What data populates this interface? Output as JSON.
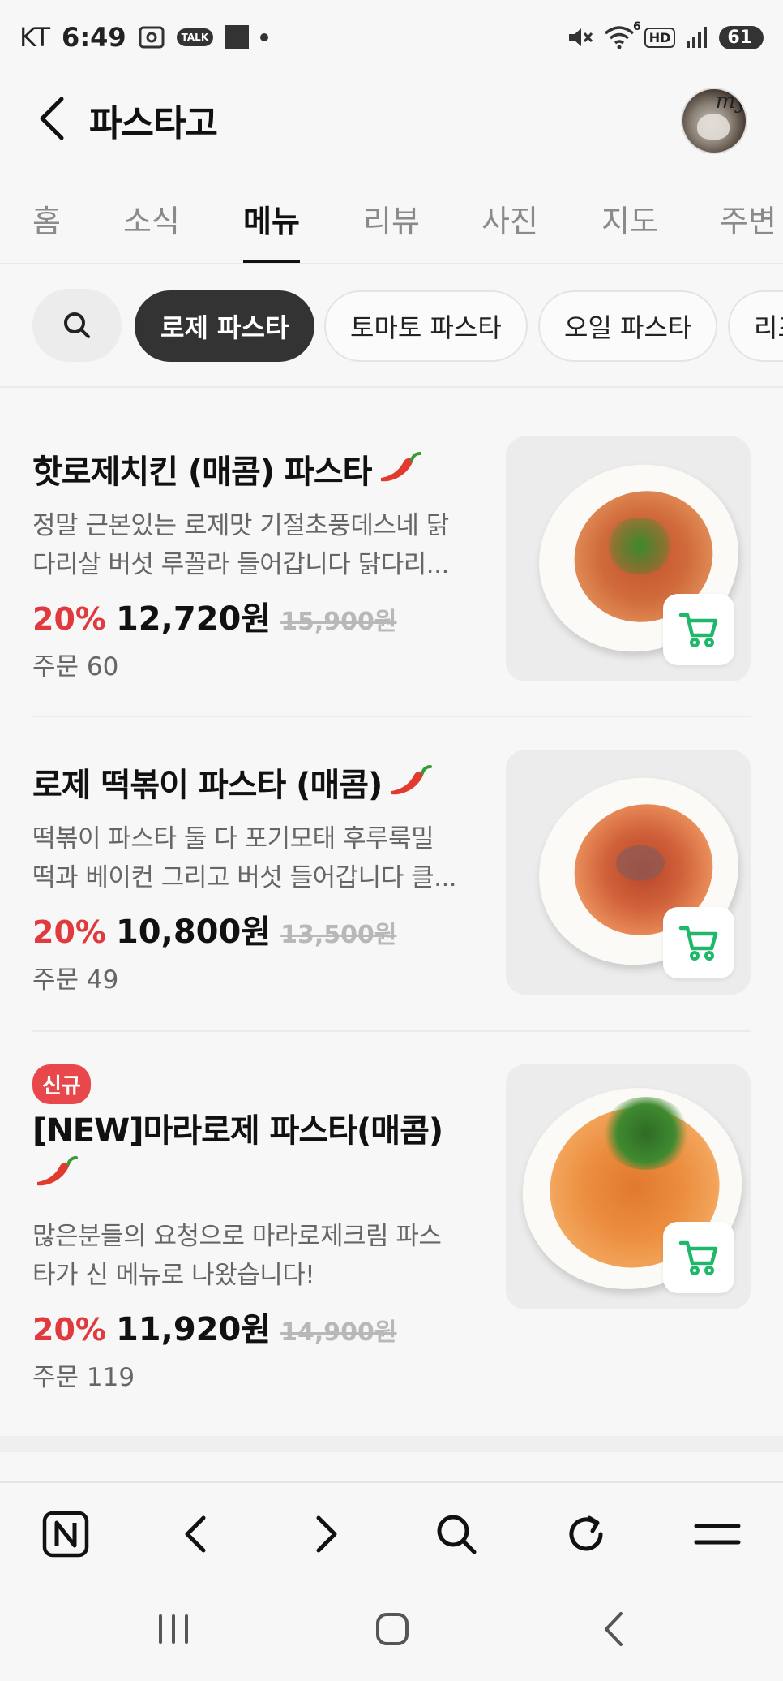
{
  "status_bar": {
    "carrier": "KT",
    "time": "6:49",
    "talk_label": "TALK",
    "hd_label": "HD",
    "network_superscript": "6",
    "battery": "61"
  },
  "header": {
    "title": "파스타고",
    "avatar_text": "my"
  },
  "tabs": [
    {
      "label": "홈",
      "active": false
    },
    {
      "label": "소식",
      "active": false
    },
    {
      "label": "메뉴",
      "active": true
    },
    {
      "label": "리뷰",
      "active": false
    },
    {
      "label": "사진",
      "active": false
    },
    {
      "label": "지도",
      "active": false
    },
    {
      "label": "주변",
      "active": false
    }
  ],
  "filters": {
    "chips": [
      "로제 파스타",
      "토마토 파스타",
      "오일 파스타",
      "리조또"
    ],
    "active_index": 0
  },
  "menu_items": [
    {
      "name": "핫로제치킨 (매콤) 파스타",
      "desc_line1": "정말 근본있는 로제맛 기절초풍데스네 닭",
      "desc_line2": "다리살 버섯 루꼴라 들어갑니다 닭다리...",
      "discount": "20%",
      "price": "12,720원",
      "original_price": "15,900원",
      "orders": "주문 60"
    },
    {
      "name": "로제 떡볶이 파스타 (매콤)",
      "desc_line1": "떡볶이 파스타 둘 다 포기모태 후루룩밀",
      "desc_line2": "떡과 베이컨 그리고 버섯 들어갑니다 클...",
      "discount": "20%",
      "price": "10,800원",
      "original_price": "13,500원",
      "orders": "주문 49"
    },
    {
      "badge": "신규",
      "name": "[NEW]마라로제 파스타(매콤)",
      "desc_line1": "많은분들의 요청으로 마라로제크림 파스",
      "desc_line2": "타가 신 메뉴로 나왔습니다!",
      "discount": "20%",
      "price": "11,920원",
      "original_price": "14,900원",
      "orders": "주문 119"
    }
  ],
  "colors": {
    "discount_red": "#e0393e",
    "cart_green": "#1fb86a",
    "active_chip": "#333333",
    "new_badge": "#e8484b"
  },
  "icons": {
    "back": "chevron-left-icon",
    "search": "search-icon",
    "cart": "cart-icon",
    "chili": "chili-pepper-icon",
    "browser": [
      "naver-home-icon",
      "browser-back-icon",
      "browser-forward-icon",
      "browser-search-icon",
      "refresh-icon",
      "menu-icon"
    ],
    "system_nav": [
      "recent-apps-icon",
      "home-icon",
      "system-back-icon"
    ]
  }
}
